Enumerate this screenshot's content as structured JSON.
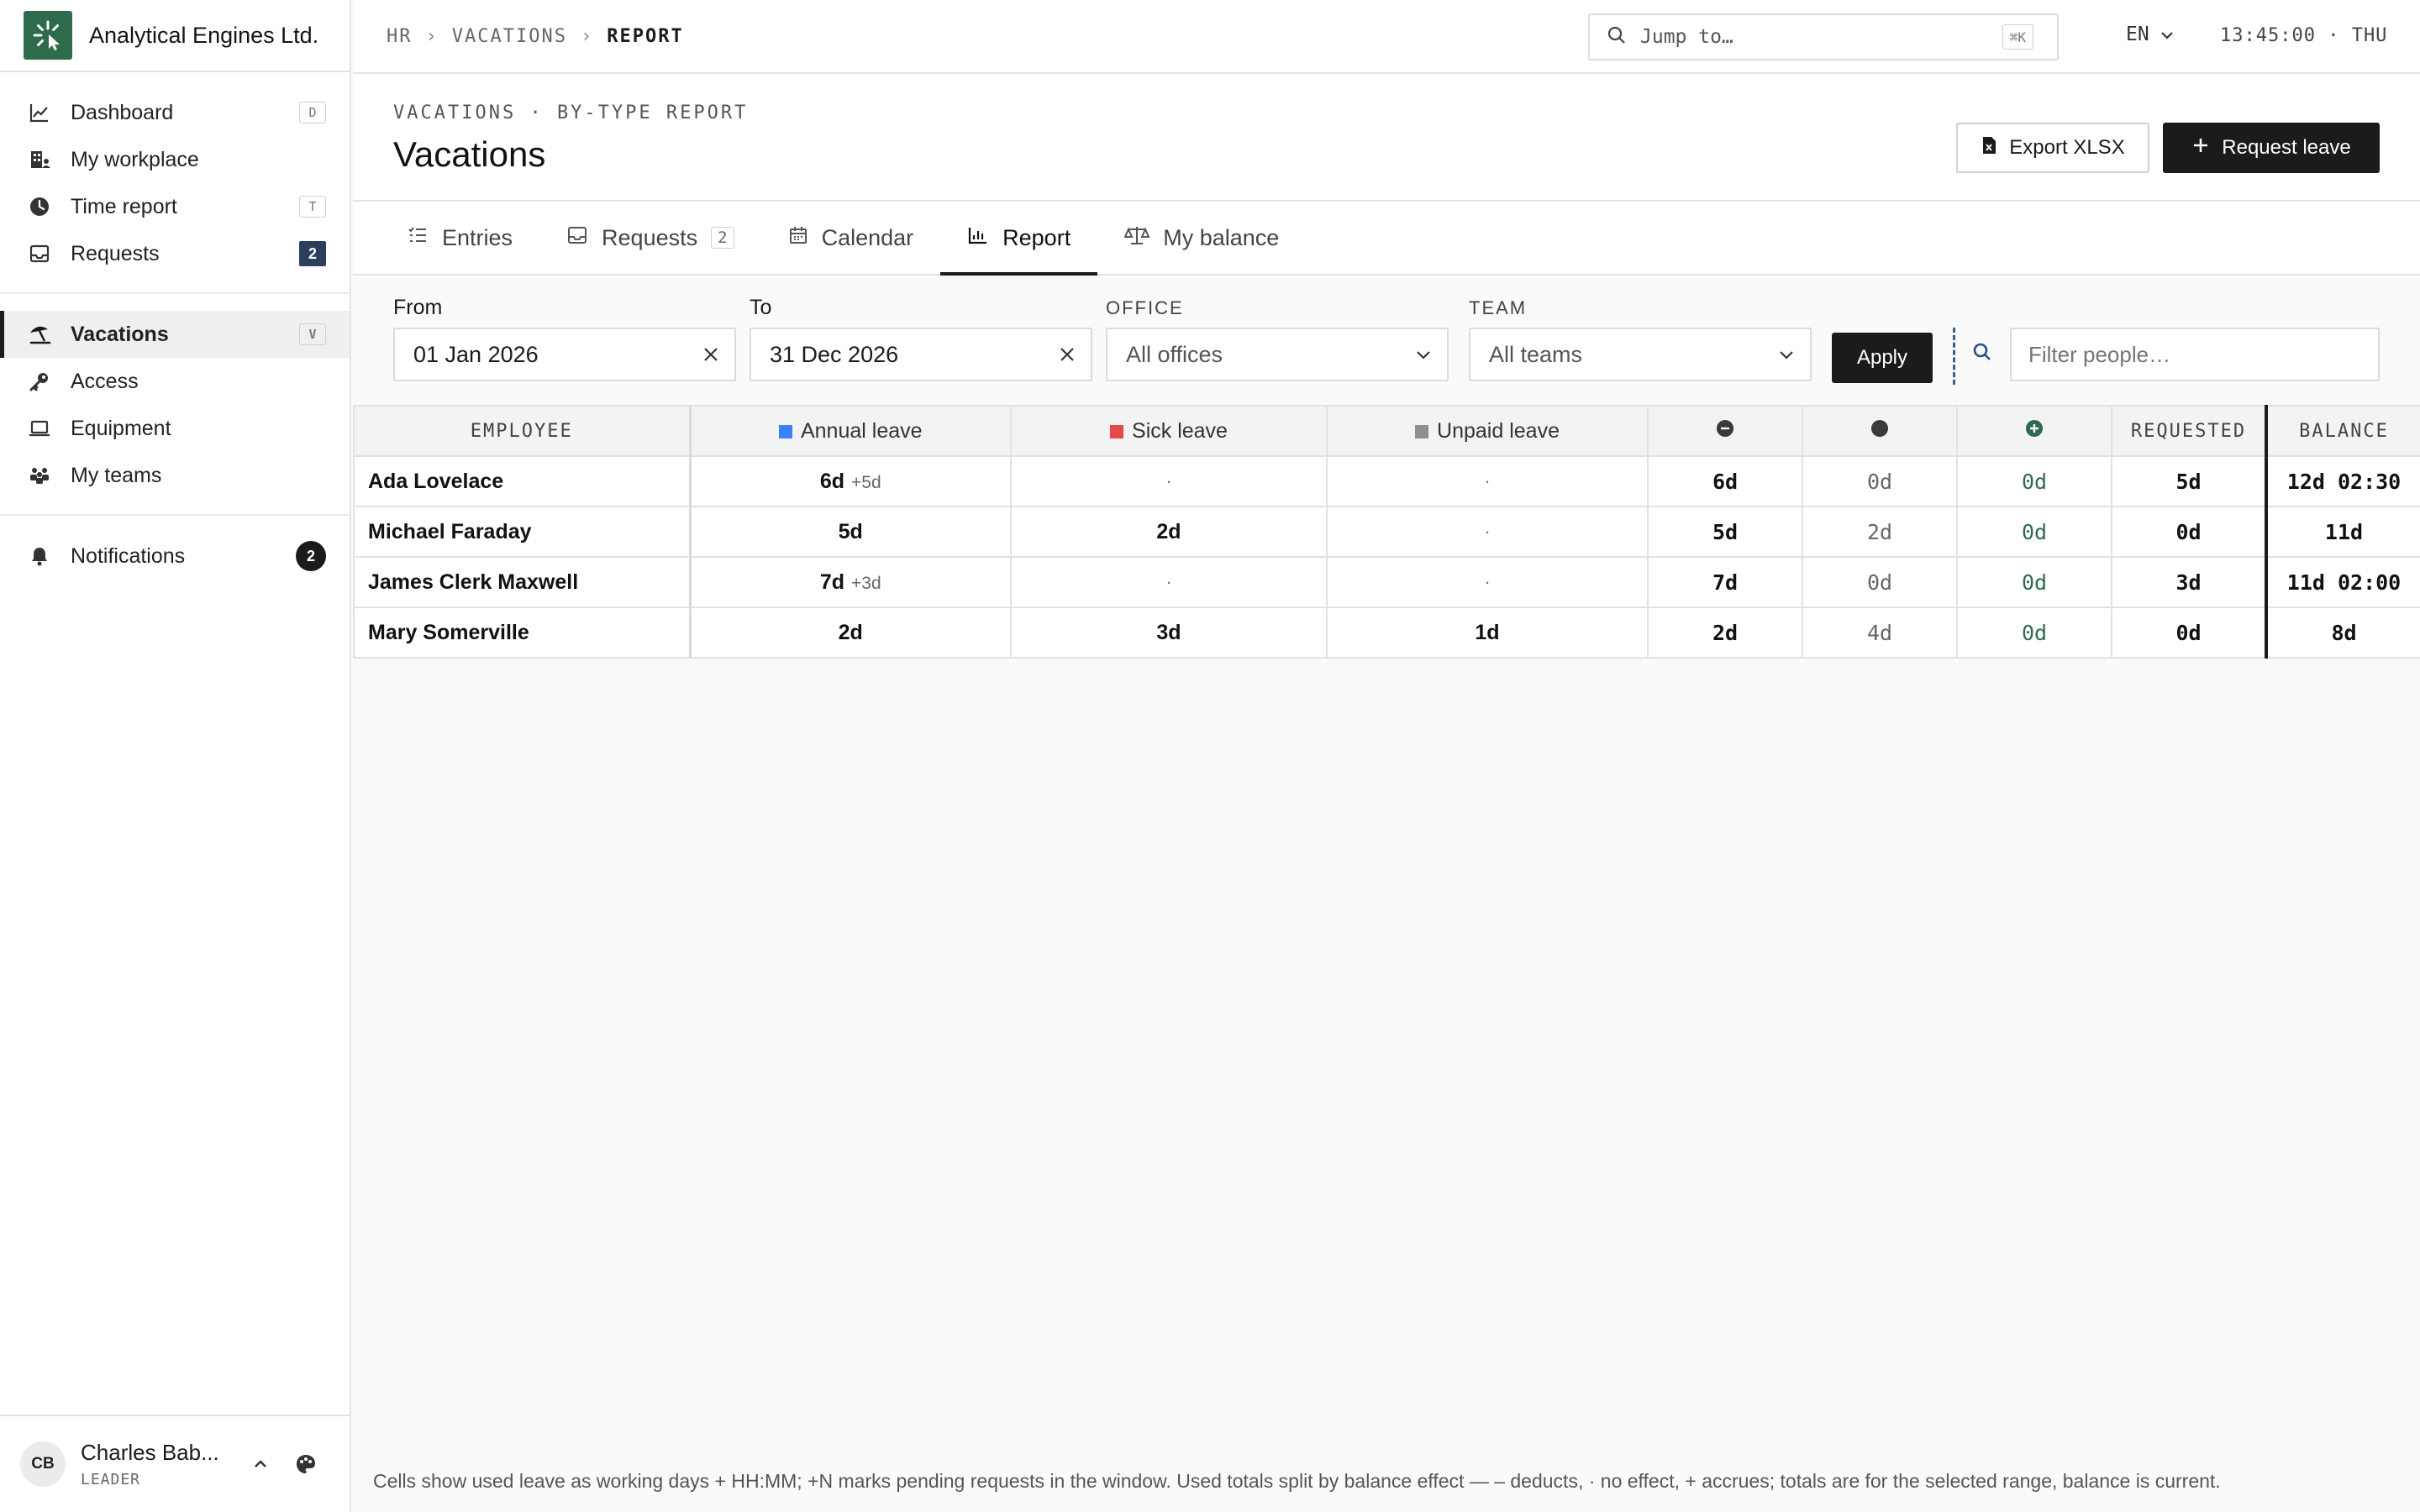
{
  "brand": {
    "name": "Analytical Engines Ltd."
  },
  "sidebar": {
    "groups": [
      [
        {
          "label": "Dashboard",
          "shortcut": "D",
          "icon": "chart-line-icon"
        },
        {
          "label": "My workplace",
          "icon": "building-icon"
        },
        {
          "label": "Time report",
          "shortcut": "T",
          "icon": "clock-icon"
        },
        {
          "label": "Requests",
          "badge": "2",
          "icon": "inbox-icon"
        }
      ],
      [
        {
          "label": "Vacations",
          "shortcut": "V",
          "icon": "umbrella-beach-icon",
          "active": true
        },
        {
          "label": "Access",
          "icon": "key-icon"
        },
        {
          "label": "Equipment",
          "icon": "laptop-icon"
        },
        {
          "label": "My teams",
          "icon": "people-icon"
        }
      ],
      [
        {
          "label": "Notifications",
          "badge": "2",
          "icon": "bell-icon"
        }
      ]
    ],
    "user": {
      "initials": "CB",
      "name": "Charles Bab...",
      "role": "LEADER"
    }
  },
  "topbar": {
    "breadcrumbs": [
      "HR",
      "VACATIONS",
      "REPORT"
    ],
    "jump_placeholder": "Jump to…",
    "jump_shortcut": "⌘K",
    "lang": "EN",
    "clock": "13:45:00 · THU"
  },
  "page": {
    "eyebrow": "VACATIONS · BY-TYPE REPORT",
    "title": "Vacations",
    "export_label": "Export XLSX",
    "request_label": "Request leave"
  },
  "tabs": [
    {
      "label": "Entries",
      "icon": "list-check-icon"
    },
    {
      "label": "Requests",
      "icon": "inbox-icon",
      "count": "2"
    },
    {
      "label": "Calendar",
      "icon": "calendar-icon"
    },
    {
      "label": "Report",
      "icon": "bar-chart-icon",
      "active": true
    },
    {
      "label": "My balance",
      "icon": "scale-icon"
    }
  ],
  "filters": {
    "from_label": "From",
    "from_value": "01 Jan 2026",
    "to_label": "To",
    "to_value": "31 Dec 2026",
    "office_label": "OFFICE",
    "office_value": "All offices",
    "team_label": "TEAM",
    "team_value": "All teams",
    "apply_label": "Apply",
    "people_placeholder": "Filter people…"
  },
  "table": {
    "headers": {
      "employee": "EMPLOYEE",
      "annual": "Annual leave",
      "sick": "Sick leave",
      "unpaid": "Unpaid leave",
      "requested": "REQUESTED",
      "balance": "BALANCE"
    },
    "colors": {
      "annual": "#3b82f6",
      "sick": "#e5484d",
      "unpaid": "#8f8f8f",
      "accrue": "#2e6b4d"
    },
    "rows": [
      {
        "name": "Ada Lovelace",
        "annual": "6d",
        "annual_pending": "+5d",
        "sick": "·",
        "unpaid": "·",
        "deducts": "6d",
        "no_effect": "0d",
        "accrues": "0d",
        "requested": "5d",
        "balance": "12d 02:30"
      },
      {
        "name": "Michael Faraday",
        "annual": "5d",
        "annual_pending": "",
        "sick": "2d",
        "unpaid": "·",
        "deducts": "5d",
        "no_effect": "2d",
        "accrues": "0d",
        "requested": "0d",
        "balance": "11d"
      },
      {
        "name": "James Clerk Maxwell",
        "annual": "7d",
        "annual_pending": "+3d",
        "sick": "·",
        "unpaid": "·",
        "deducts": "7d",
        "no_effect": "0d",
        "accrues": "0d",
        "requested": "3d",
        "balance": "11d 02:00"
      },
      {
        "name": "Mary Somerville",
        "annual": "2d",
        "annual_pending": "",
        "sick": "3d",
        "unpaid": "1d",
        "deducts": "2d",
        "no_effect": "4d",
        "accrues": "0d",
        "requested": "0d",
        "balance": "8d"
      }
    ]
  },
  "footnote": "Cells show used leave as working days + HH:MM; +N marks pending requests in the window. Used totals split by balance effect — – deducts, · no effect, + accrues; totals are for the selected range, balance is current."
}
